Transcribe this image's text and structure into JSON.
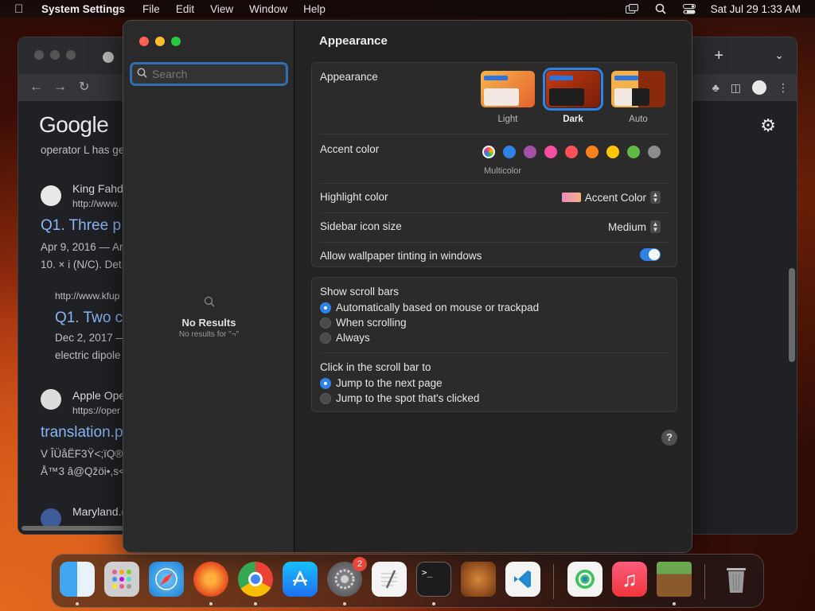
{
  "menubar": {
    "app_name": "System Settings",
    "menus": [
      "File",
      "Edit",
      "View",
      "Window",
      "Help"
    ],
    "date_time": "Sat Jul 29  1:33 AM"
  },
  "browser": {
    "results": [
      {
        "text": "operator L has ge"
      },
      {
        "site": "King Fahd",
        "url": "http://www.",
        "title": "Q1. Three p",
        "date": "Apr 9, 2016 — Ar",
        "snippet": "10. × i (N/C). Det"
      },
      {
        "url": "http://www.kfup",
        "title": "Q1. Two c",
        "date": "Dec 2, 2017 —",
        "snippet": "electric dipole"
      },
      {
        "site": "Apple Ope",
        "url": "https://oper",
        "title": "translation.p",
        "line1": "V ÎÜåËF3Ÿ<;ïQ®",
        "line2": "Å™3 â@Qžöi•,s<"
      },
      {
        "site": "Maryland.("
      }
    ],
    "logo": "Google"
  },
  "settings": {
    "search_placeholder": "Search",
    "no_results_title": "No Results",
    "no_results_sub": "No results for \"¬\"",
    "page_title": "Appearance",
    "appearance_label": "Appearance",
    "themes": [
      {
        "label": "Light",
        "selected": false
      },
      {
        "label": "Dark",
        "selected": true
      },
      {
        "label": "Auto",
        "selected": false
      }
    ],
    "accent_label": "Accent color",
    "accent_colors": [
      "multicolor",
      "#2f82e6",
      "#a550a7",
      "#f74f9e",
      "#ff5257",
      "#f7821b",
      "#ffc600",
      "#62ba46",
      "#8c8c8c"
    ],
    "accent_selected_name": "Multicolor",
    "highlight_label": "Highlight color",
    "highlight_value": "Accent Color",
    "sidebar_icon_label": "Sidebar icon size",
    "sidebar_icon_value": "Medium",
    "wallpaper_tint_label": "Allow wallpaper tinting in windows",
    "wallpaper_tint_on": true,
    "scroll_bars_label": "Show scroll bars",
    "scroll_bar_options": [
      {
        "label": "Automatically based on mouse or trackpad",
        "selected": true
      },
      {
        "label": "When scrolling",
        "selected": false
      },
      {
        "label": "Always",
        "selected": false
      }
    ],
    "click_label": "Click in the scroll bar to",
    "click_options": [
      {
        "label": "Jump to the next page",
        "selected": true
      },
      {
        "label": "Jump to the spot that's clicked",
        "selected": false
      }
    ],
    "help": "?"
  },
  "dock": {
    "settings_badge": "2"
  }
}
